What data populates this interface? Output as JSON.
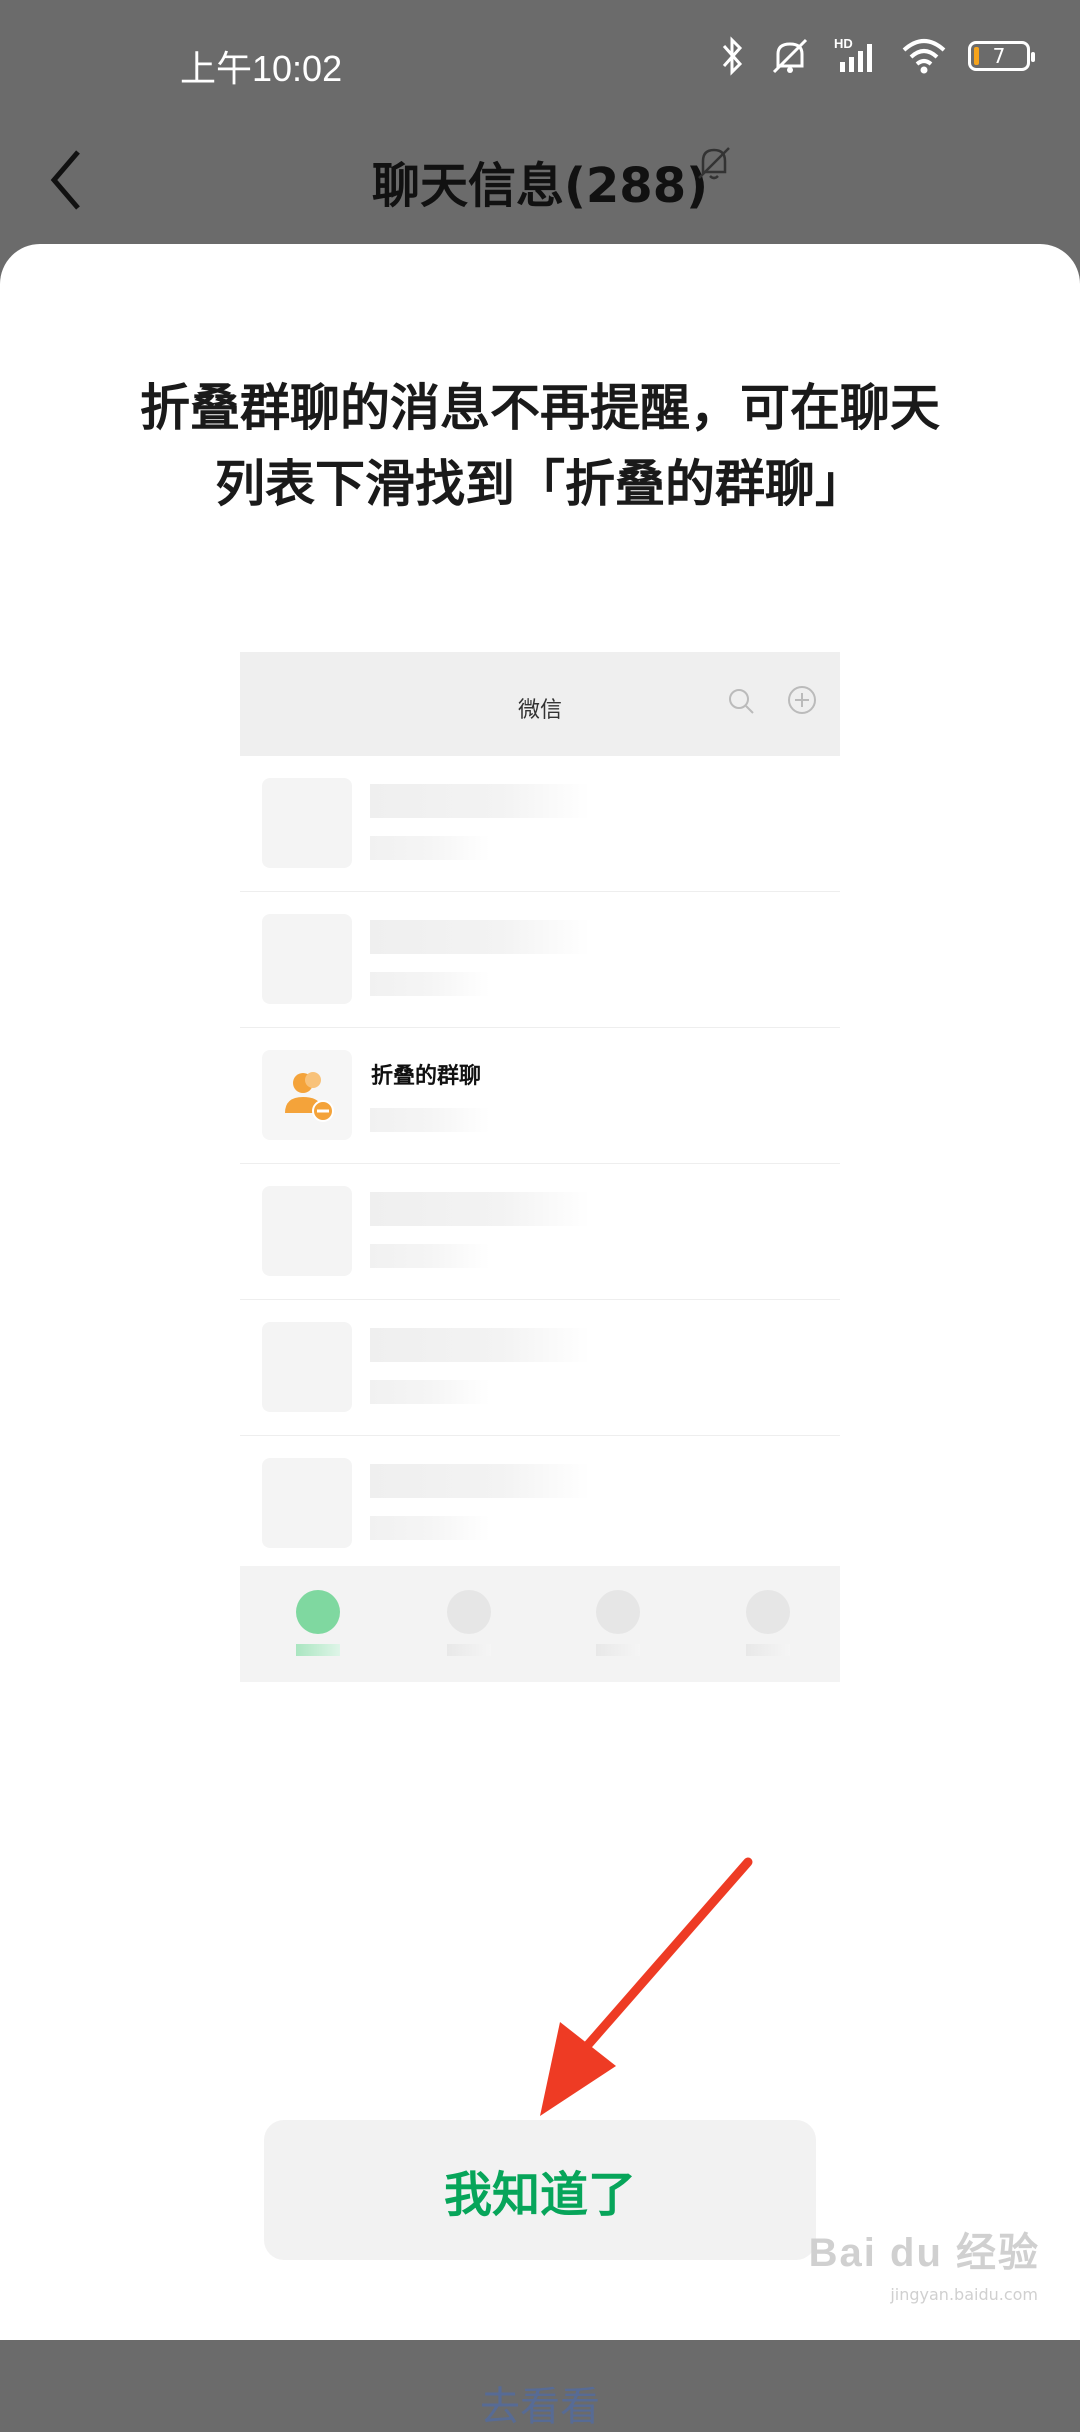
{
  "status_bar": {
    "time": "上午10:02",
    "network": "HD",
    "battery": "7",
    "icons": [
      "bluetooth-icon",
      "mute-vibrate-icon",
      "signal-icon",
      "wifi-icon",
      "battery-icon"
    ]
  },
  "nav": {
    "title": "聊天信息(288)",
    "icons": [
      "back-icon",
      "mute-bell-icon"
    ]
  },
  "dialog": {
    "heading_line1": "折叠群聊的消息不再提醒，可在聊天",
    "heading_line2": "列表下滑找到「折叠的群聊」",
    "primary_button": "我知道了",
    "secondary_link": "去看看",
    "accent": "#07a55a",
    "link_color": "#576b95"
  },
  "preview": {
    "title": "微信",
    "folded_label": "折叠的群聊",
    "icons": [
      "search-icon",
      "plus-circle-icon",
      "folded-group-icon"
    ]
  },
  "annotation": {
    "arrow_color": "#ee3b24"
  },
  "watermark": {
    "text": "Bai du 经验",
    "sub": "jingyan.baidu.com"
  }
}
